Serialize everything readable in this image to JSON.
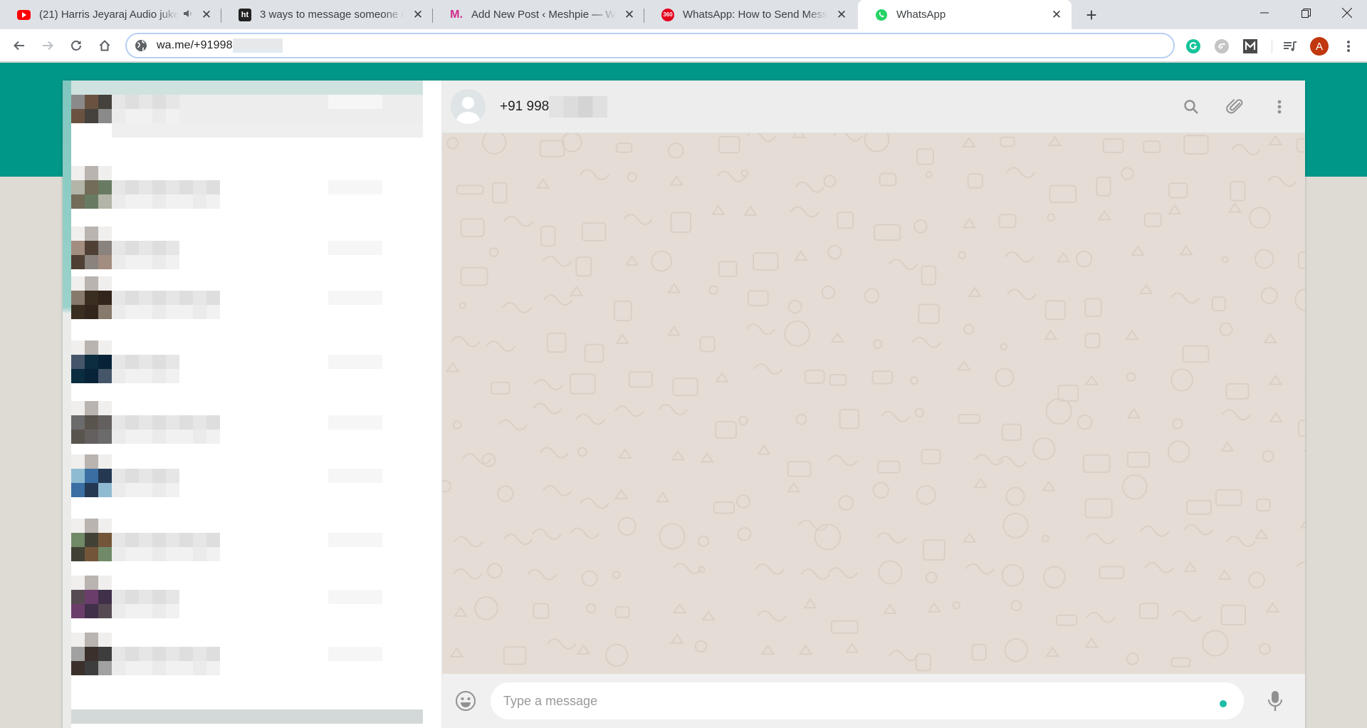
{
  "browser": {
    "tabs": [
      {
        "title": "(21) Harris Jeyaraj Audio jukebox",
        "favicon": "youtube-icon",
        "audio": true,
        "active": false
      },
      {
        "title": "3 ways to message someone on WhatsApp",
        "favicon": "ht-icon",
        "favicon_text": "ht",
        "active": false
      },
      {
        "title": "Add New Post ‹ Meshpie — WordPress",
        "favicon": "meshpie-icon",
        "favicon_text": "M.",
        "active": false
      },
      {
        "title": "WhatsApp: How to Send Messages",
        "favicon": "gadgets360-icon",
        "favicon_text": "360",
        "active": false
      },
      {
        "title": "WhatsApp",
        "favicon": "whatsapp-icon",
        "active": true
      }
    ],
    "new_tab_label": "+",
    "window_controls": {
      "minimize": "—",
      "maximize": "❐",
      "close": "✕"
    },
    "address_bar": {
      "url_visible": "wa.me/+91998",
      "url_redacted": true
    },
    "extensions": [
      {
        "name": "grammarly-icon",
        "label": "G",
        "color": "#15c39a"
      },
      {
        "name": "extension-gray-icon",
        "color": "#b5b5b5"
      },
      {
        "name": "m-extension-icon",
        "label": "M",
        "color": "#4a4a4a"
      }
    ],
    "profile": {
      "initial": "A",
      "color": "#c1370f"
    }
  },
  "whatsapp": {
    "colors": {
      "teal": "#009688",
      "chat_bg": "#e5ddd5",
      "header_bg": "#ededed",
      "footer_bg": "#f0f0f0",
      "accent": "#1ebea5"
    },
    "sidebar": {
      "redacted": true
    },
    "chat": {
      "contact_name": "+91 998",
      "contact_redacted": true,
      "header_icons": [
        "search-icon",
        "attach-icon",
        "menu-icon"
      ],
      "input_placeholder": "Type a message"
    }
  }
}
